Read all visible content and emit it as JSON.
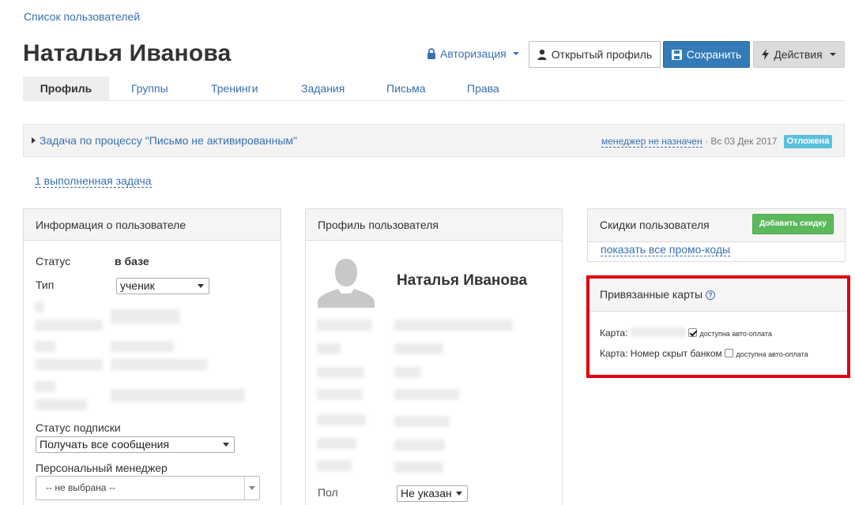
{
  "breadcrumb": "Список пользователей",
  "page_title": "Наталья Иванова",
  "header": {
    "auth_label": "Авторизация",
    "open_profile_label": "Открытый профиль",
    "save_label": "Сохранить",
    "actions_label": "Действия"
  },
  "tabs": [
    "Профиль",
    "Группы",
    "Тренинги",
    "Задания",
    "Письма",
    "Права"
  ],
  "task": {
    "title": "Задача по процессу \"Письмо не активированным\"",
    "manager": "менеджер не назначен",
    "date": "· Вс 03 Дек 2017",
    "status": "Отложена"
  },
  "completed_tasks": "1 выполненная задача",
  "user_info": {
    "header": "Информация о пользователе",
    "status_label": "Статус",
    "status_value": "в базе",
    "type_label": "Тип",
    "type_value": "ученик",
    "subscription_label": "Статус подписки",
    "subscription_value": "Получать все сообщения",
    "manager_label": "Персональный менеджер",
    "manager_value": "-- не выбрана --"
  },
  "user_profile": {
    "header": "Профиль пользователя",
    "name": "Наталья Иванова",
    "gender_label": "Пол",
    "gender_value": "Не указан"
  },
  "discounts": {
    "header": "Скидки пользователя",
    "add_button": "Добавить скидку",
    "show_promos": "показать все промо-коды"
  },
  "cards": {
    "header": "Привязанные карты",
    "help_icon": "?",
    "card1_label": "Карта:",
    "card1_autopay": "доступна авто-оплата",
    "card2_label": "Карта: Номер скрыт банком",
    "card2_autopay": "доступна авто-оплата"
  },
  "colors": {
    "link": "#3a6fb0",
    "save_button": "#337ab7",
    "badge": "#5bc0de",
    "add_button": "#5cb85c",
    "highlight": "#e0000f"
  }
}
